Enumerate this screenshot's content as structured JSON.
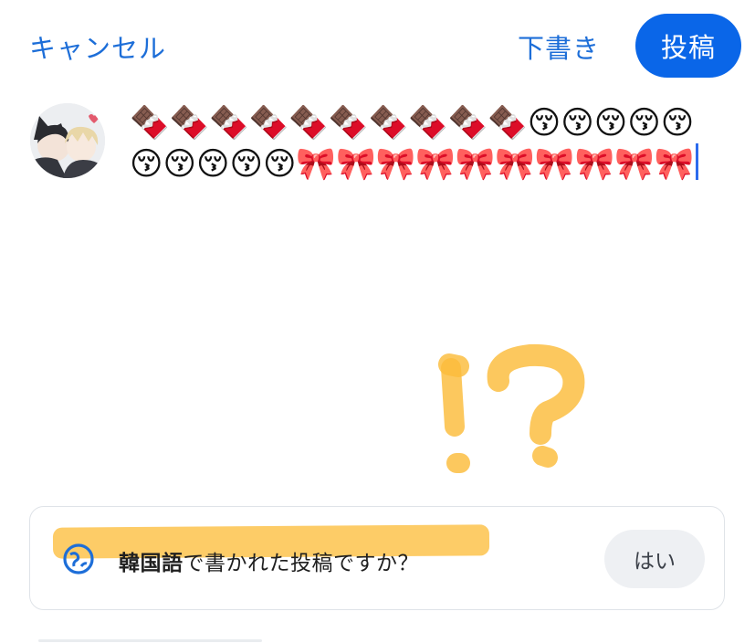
{
  "header": {
    "cancel_label": "キャンセル",
    "draft_label": "下書き",
    "post_label": "投稿"
  },
  "composer": {
    "text": "🍫🍫🍫🍫🍫🍫🍫🍫🍫🍫😚😚😚😚😚😚😚😚😚😚🎀🎀🎀🎀🎀🎀🎀🎀🎀🎀",
    "avatar_icon": "avatar-illustration"
  },
  "translation_prompt": {
    "icon": "globe-icon",
    "language": "韓国語",
    "question_suffix": "で書かれた投稿ですか？",
    "yes_label": "はい"
  },
  "colors": {
    "accent": "#0a66e8",
    "link": "#1d6ed8",
    "highlight": "#fdbe3c",
    "caret": "#2c6bed"
  }
}
